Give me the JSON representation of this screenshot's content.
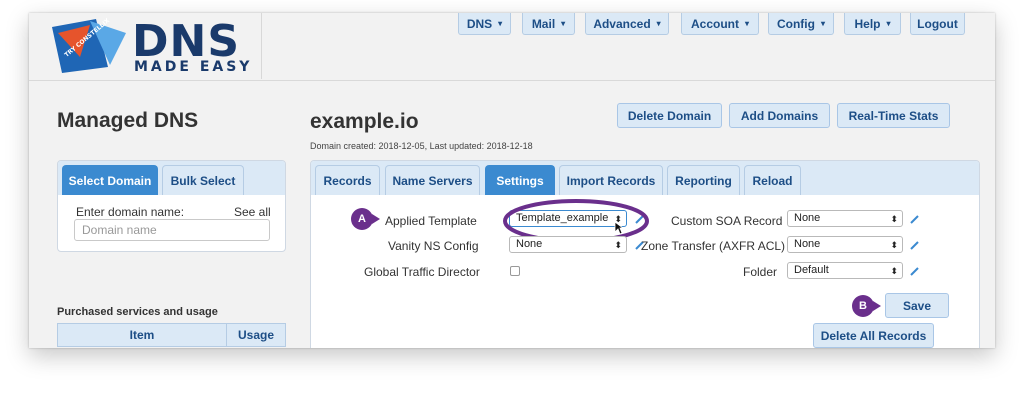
{
  "logo": {
    "ribbon": "TRY CONSTELLIX",
    "dns": "DNS",
    "made_easy": "MADE EASY"
  },
  "topnav": [
    {
      "label": "DNS",
      "caret": "▾"
    },
    {
      "label": "Mail",
      "caret": "▾"
    },
    {
      "label": "Advanced",
      "caret": "▾"
    },
    {
      "label": "Account",
      "caret": "▾"
    },
    {
      "label": "Config",
      "caret": "▾"
    },
    {
      "label": "Help",
      "caret": "▾"
    },
    {
      "label": "Logout"
    }
  ],
  "sidebar": {
    "title": "Managed DNS",
    "tabs": [
      "Select Domain",
      "Bulk Select"
    ],
    "domain_label": "Enter domain name:",
    "see_all": "See all",
    "domain_placeholder": "Domain name",
    "purchased_title": "Purchased services and usage",
    "table_headers": [
      "Item",
      "Usage"
    ]
  },
  "main": {
    "domain": "example.io",
    "meta": "Domain created: 2018-12-05, Last updated: 2018-12-18",
    "actions": [
      "Delete Domain",
      "Add Domains",
      "Real-Time Stats"
    ],
    "tabs": [
      "Records",
      "Name Servers",
      "Settings",
      "Import Records",
      "Reporting",
      "Reload"
    ],
    "active_tab": "Settings"
  },
  "settings": {
    "applied_template": {
      "label": "Applied Template",
      "value": "Template_example"
    },
    "vanity_ns": {
      "label": "Vanity NS Config",
      "value": "None"
    },
    "gtd": {
      "label": "Global Traffic Director",
      "checked": false
    },
    "custom_soa": {
      "label": "Custom SOA Record",
      "value": "None"
    },
    "zone_transfer": {
      "label": "Zone Transfer (AXFR ACL)",
      "value": "None"
    },
    "folder": {
      "label": "Folder",
      "value": "Default"
    },
    "save": "Save",
    "delete_all": "Delete All Records"
  },
  "annotations": {
    "a": "A",
    "b": "B"
  },
  "select_arrow": "⬍",
  "colors": {
    "accent": "#3b8ad0",
    "button_bg": "#dbe9f6",
    "button_text": "#1d4e86",
    "annotation": "#6a2f8c"
  }
}
